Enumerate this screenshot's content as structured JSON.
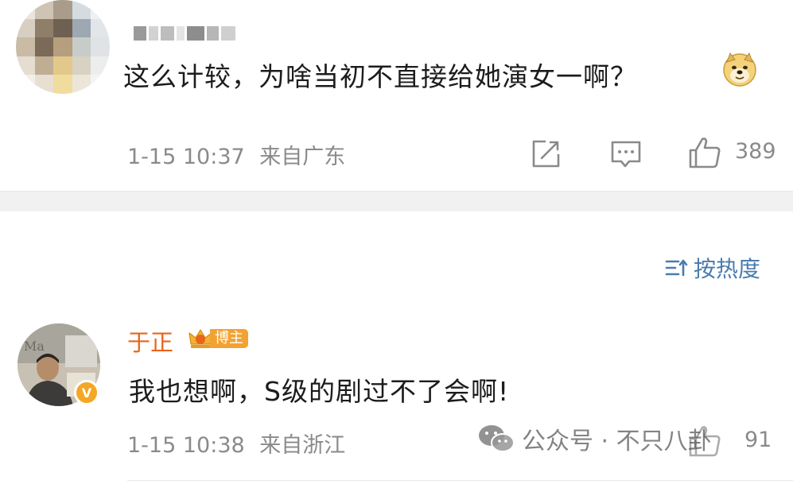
{
  "comments": [
    {
      "username": "",
      "text": "这么计较，为啥当初不直接给她演女一啊？",
      "emoji": "doge-emoji",
      "timestamp": "1-15 10:37",
      "location": "来自广东",
      "likes": "389"
    },
    {
      "username": "于正",
      "badge": "博主",
      "text": "我也想啊，S级的剧过不了会啊!",
      "timestamp": "1-15 10:38",
      "location": "来自浙江",
      "likes": "91"
    }
  ],
  "sort": {
    "label": "按热度"
  },
  "watermark": {
    "text": "公众号 · 不只八卦"
  },
  "colors": {
    "accent_name": "#e8641b",
    "link_blue": "#4a7bb0",
    "meta_gray": "#8a8a8a",
    "badge_orange": "#f2a232"
  }
}
